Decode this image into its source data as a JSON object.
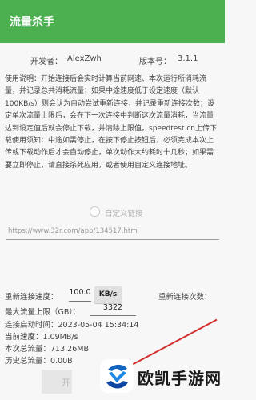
{
  "app": {
    "title": "流量杀手"
  },
  "info": {
    "developer_label": "开发者：",
    "developer": "AlexZwh",
    "version_label": "版本号：",
    "version": "3.1.1"
  },
  "description": "使用说明：开始连接后会实时计算当前网速、本次运行所消耗流量，并记录总共消耗流量；如果中途速度低于设定速度（默认100KB/s）则会认为自动尝试重新连接，并记录重新连接次数；设定单次流量上限后，会在下一次连接中判断这次流量消耗，当流量达到设定值后就会停止下载，并清除上限值。speedtest.cn上传下载使用须知：中途如需停止，在按下停止按钮后，必须完成本次上传或下载动作后才会自动停止，单次动作大约耗时十几秒；如果需要立即停止，请直接杀死应用，或者使用自定义连接地址。",
  "custom_link": {
    "label": "自定义链接",
    "selected": false
  },
  "url_field": {
    "value": "https://www.32r.com/app/134517.html"
  },
  "settings": {
    "reconnect_speed_label": "重新连接速度：",
    "reconnect_speed_value": "100.0",
    "unit": "KB/s",
    "reconnect_count_label": "重新连接次数：",
    "max_flow_label": "最大流量上限（GB）：",
    "max_flow_value": "3322"
  },
  "stats": {
    "start_time_label": "连接启动时间：",
    "start_time": "2023-05-04 15:34:14",
    "current_speed_label": "当前速度：",
    "current_speed": "1.09MB/s",
    "session_total_label": "本次总流量：",
    "session_total": "713.26MB",
    "history_total_label": "历史总流量：",
    "history_total": "0.00B"
  },
  "actions": {
    "start_label": "开"
  },
  "watermark": {
    "text": "欧凯手游网"
  }
}
